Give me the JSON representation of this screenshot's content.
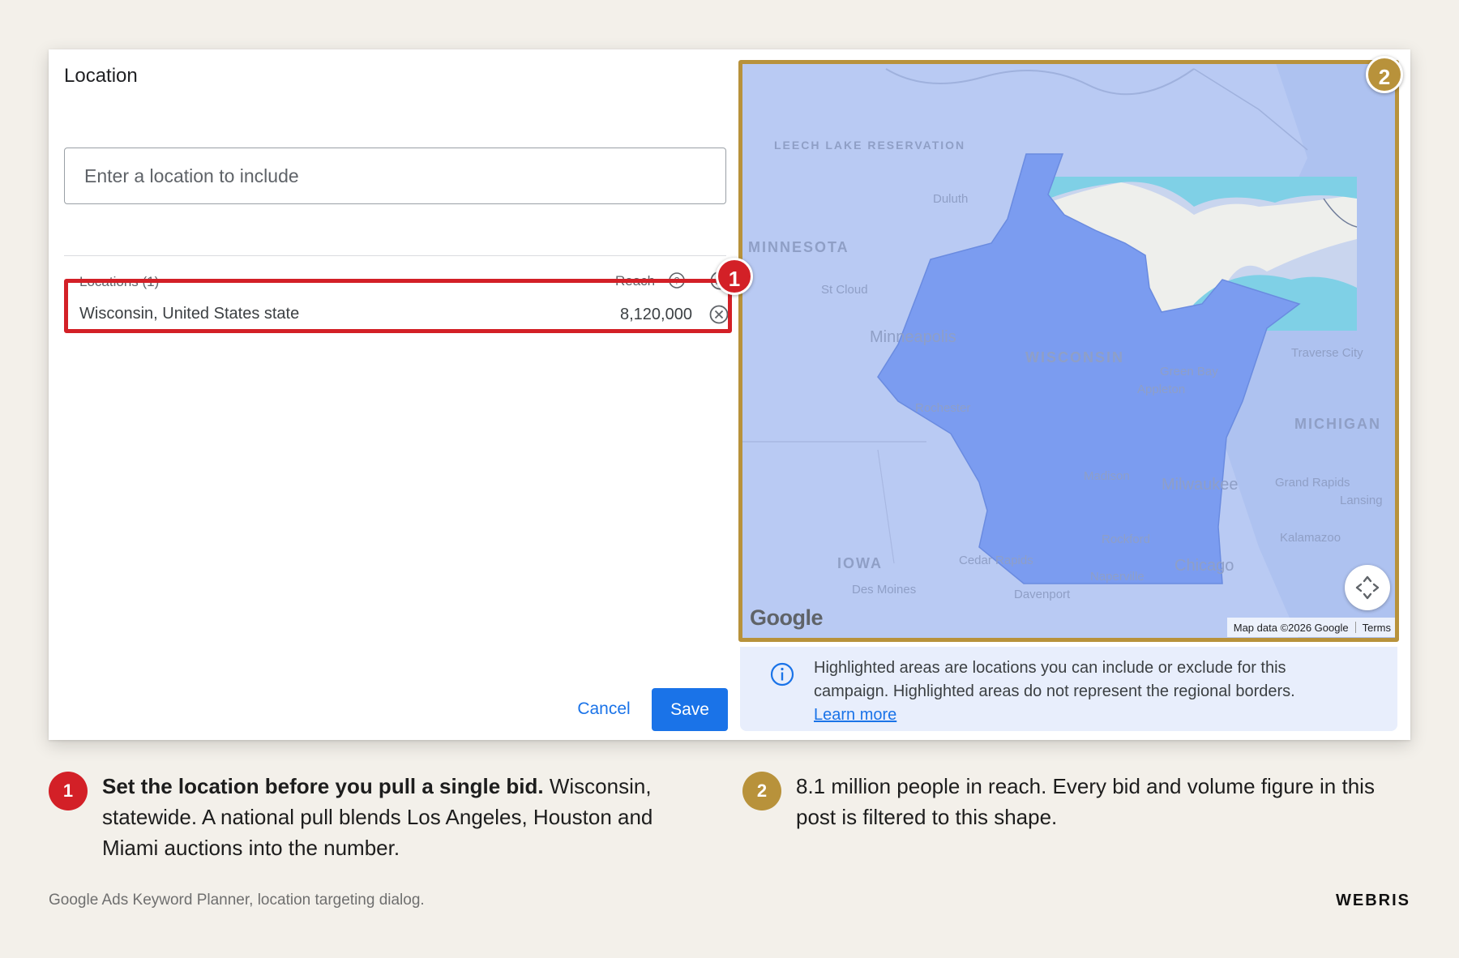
{
  "dialog": {
    "title": "Location",
    "search_placeholder": "Enter a location to include",
    "locations_header": "Locations (1)",
    "reach_header": "Reach",
    "selected_location": {
      "name": "Wisconsin, United States state",
      "reach": "8,120,000"
    },
    "cancel_label": "Cancel",
    "save_label": "Save"
  },
  "map": {
    "region_labels": [
      "MINNESOTA",
      "WISCONSIN",
      "IOWA",
      "MICHIGAN",
      "LEECH LAKE RESERVATION"
    ],
    "city_labels": [
      "Minneapolis",
      "St Cloud",
      "Rochester",
      "Green Bay",
      "Appleton",
      "Madison",
      "Milwaukee",
      "Rockford",
      "Chicago",
      "Naperville",
      "Cedar Rapids",
      "Des Moines",
      "Davenport",
      "Grand Rapids",
      "Kalamazoo",
      "Traverse City",
      "Lansing",
      "Duluth"
    ],
    "logo_text": "Google",
    "attribution": "Map data ©2026 Google",
    "terms": "Terms",
    "info_text": "Highlighted areas are locations you can include or exclude for this campaign. Highlighted areas do not represent the regional borders.",
    "learn_more": "Learn more"
  },
  "badges": {
    "one": "1",
    "two": "2"
  },
  "callouts": [
    {
      "number": "1",
      "bold": "Set the location before you pull a single bid.",
      "text": " Wisconsin, statewide. A national pull blends Los Angeles, Houston and Miami auctions into the number."
    },
    {
      "number": "2",
      "text": "8.1 million people in reach. Every bid and volume figure in this post is filtered to this shape."
    }
  ],
  "footer": {
    "caption": "Google Ads Keyword Planner, location targeting dialog.",
    "brand": "WEBRIS"
  },
  "colors": {
    "highlight_red": "#d32027",
    "highlight_gold": "#b8923b",
    "primary_blue": "#1a73e8",
    "region_fill": "#7b9cf0"
  }
}
